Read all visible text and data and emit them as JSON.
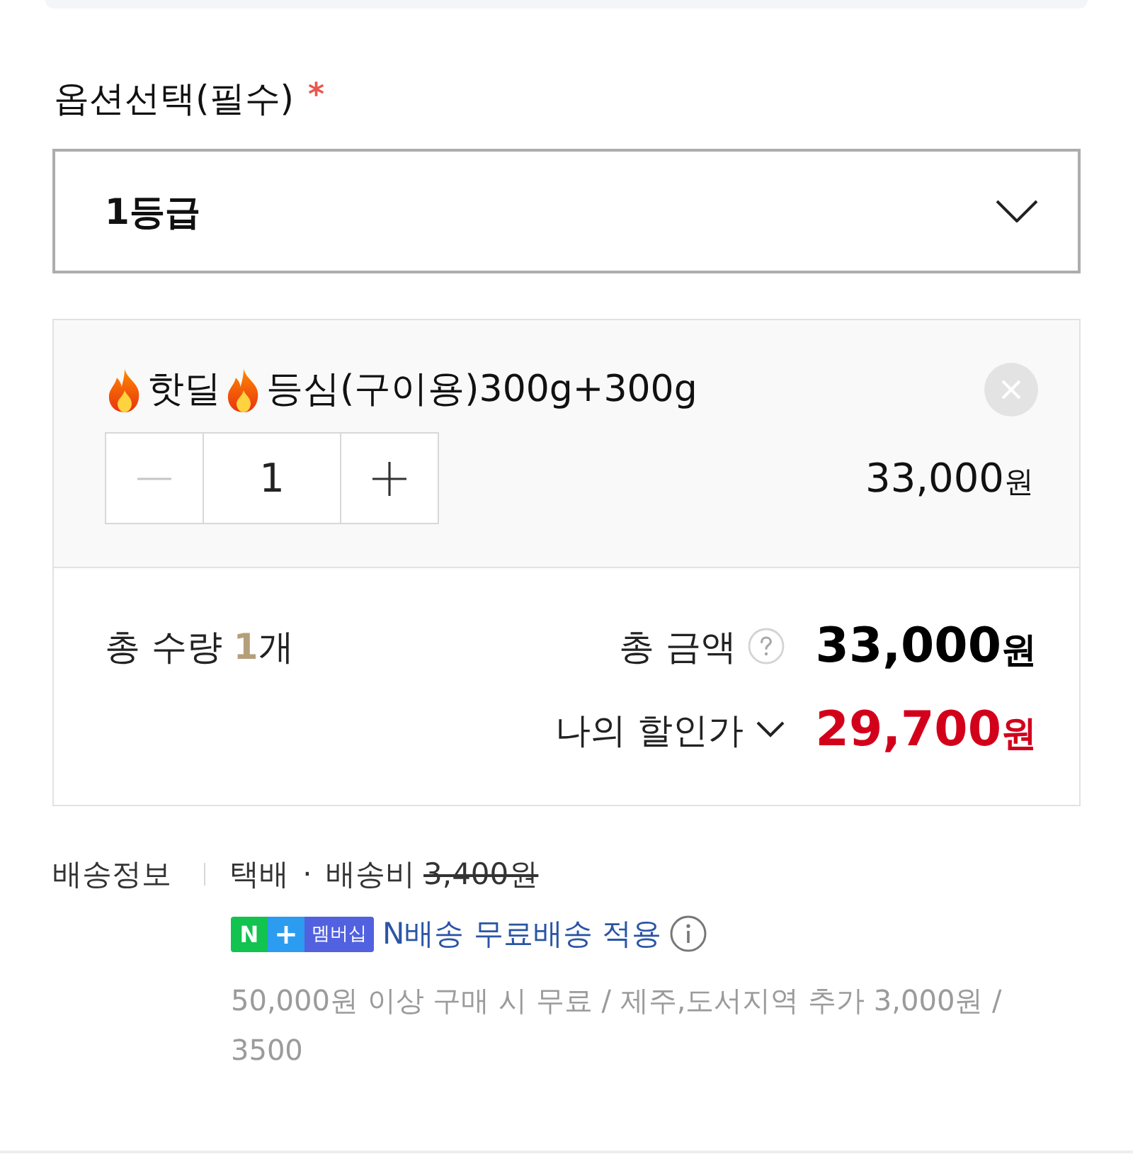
{
  "option_select": {
    "label": "옵션선택(필수)",
    "required_mark": "*",
    "value": "1등급"
  },
  "selected_option": {
    "title": [
      "핫딜",
      "등심(구이용)300g+300g"
    ],
    "quantity": "1",
    "decrease_disabled": true,
    "price": "33,000",
    "currency": "원"
  },
  "summary": {
    "quantity_label": "총 수량",
    "quantity": "1",
    "quantity_unit": "개",
    "total_label": "총 금액",
    "total": "33,000",
    "total_currency": "원",
    "discount_label": "나의 할인가",
    "discount_expanded": false,
    "discount": "29,700",
    "discount_currency": "원"
  },
  "shipping": {
    "label": "배송정보",
    "method": "택배 · 배송비",
    "fee": "3,400원",
    "fee_struck": true,
    "membership_badge": {
      "n": "N",
      "plus": "+",
      "text": "멤버십"
    },
    "free_note": "N배송 무료배송 적용",
    "conditions": "50,000원 이상 구매 시 무료 / 제주,도서지역 추가 3,000원 / 3500"
  }
}
